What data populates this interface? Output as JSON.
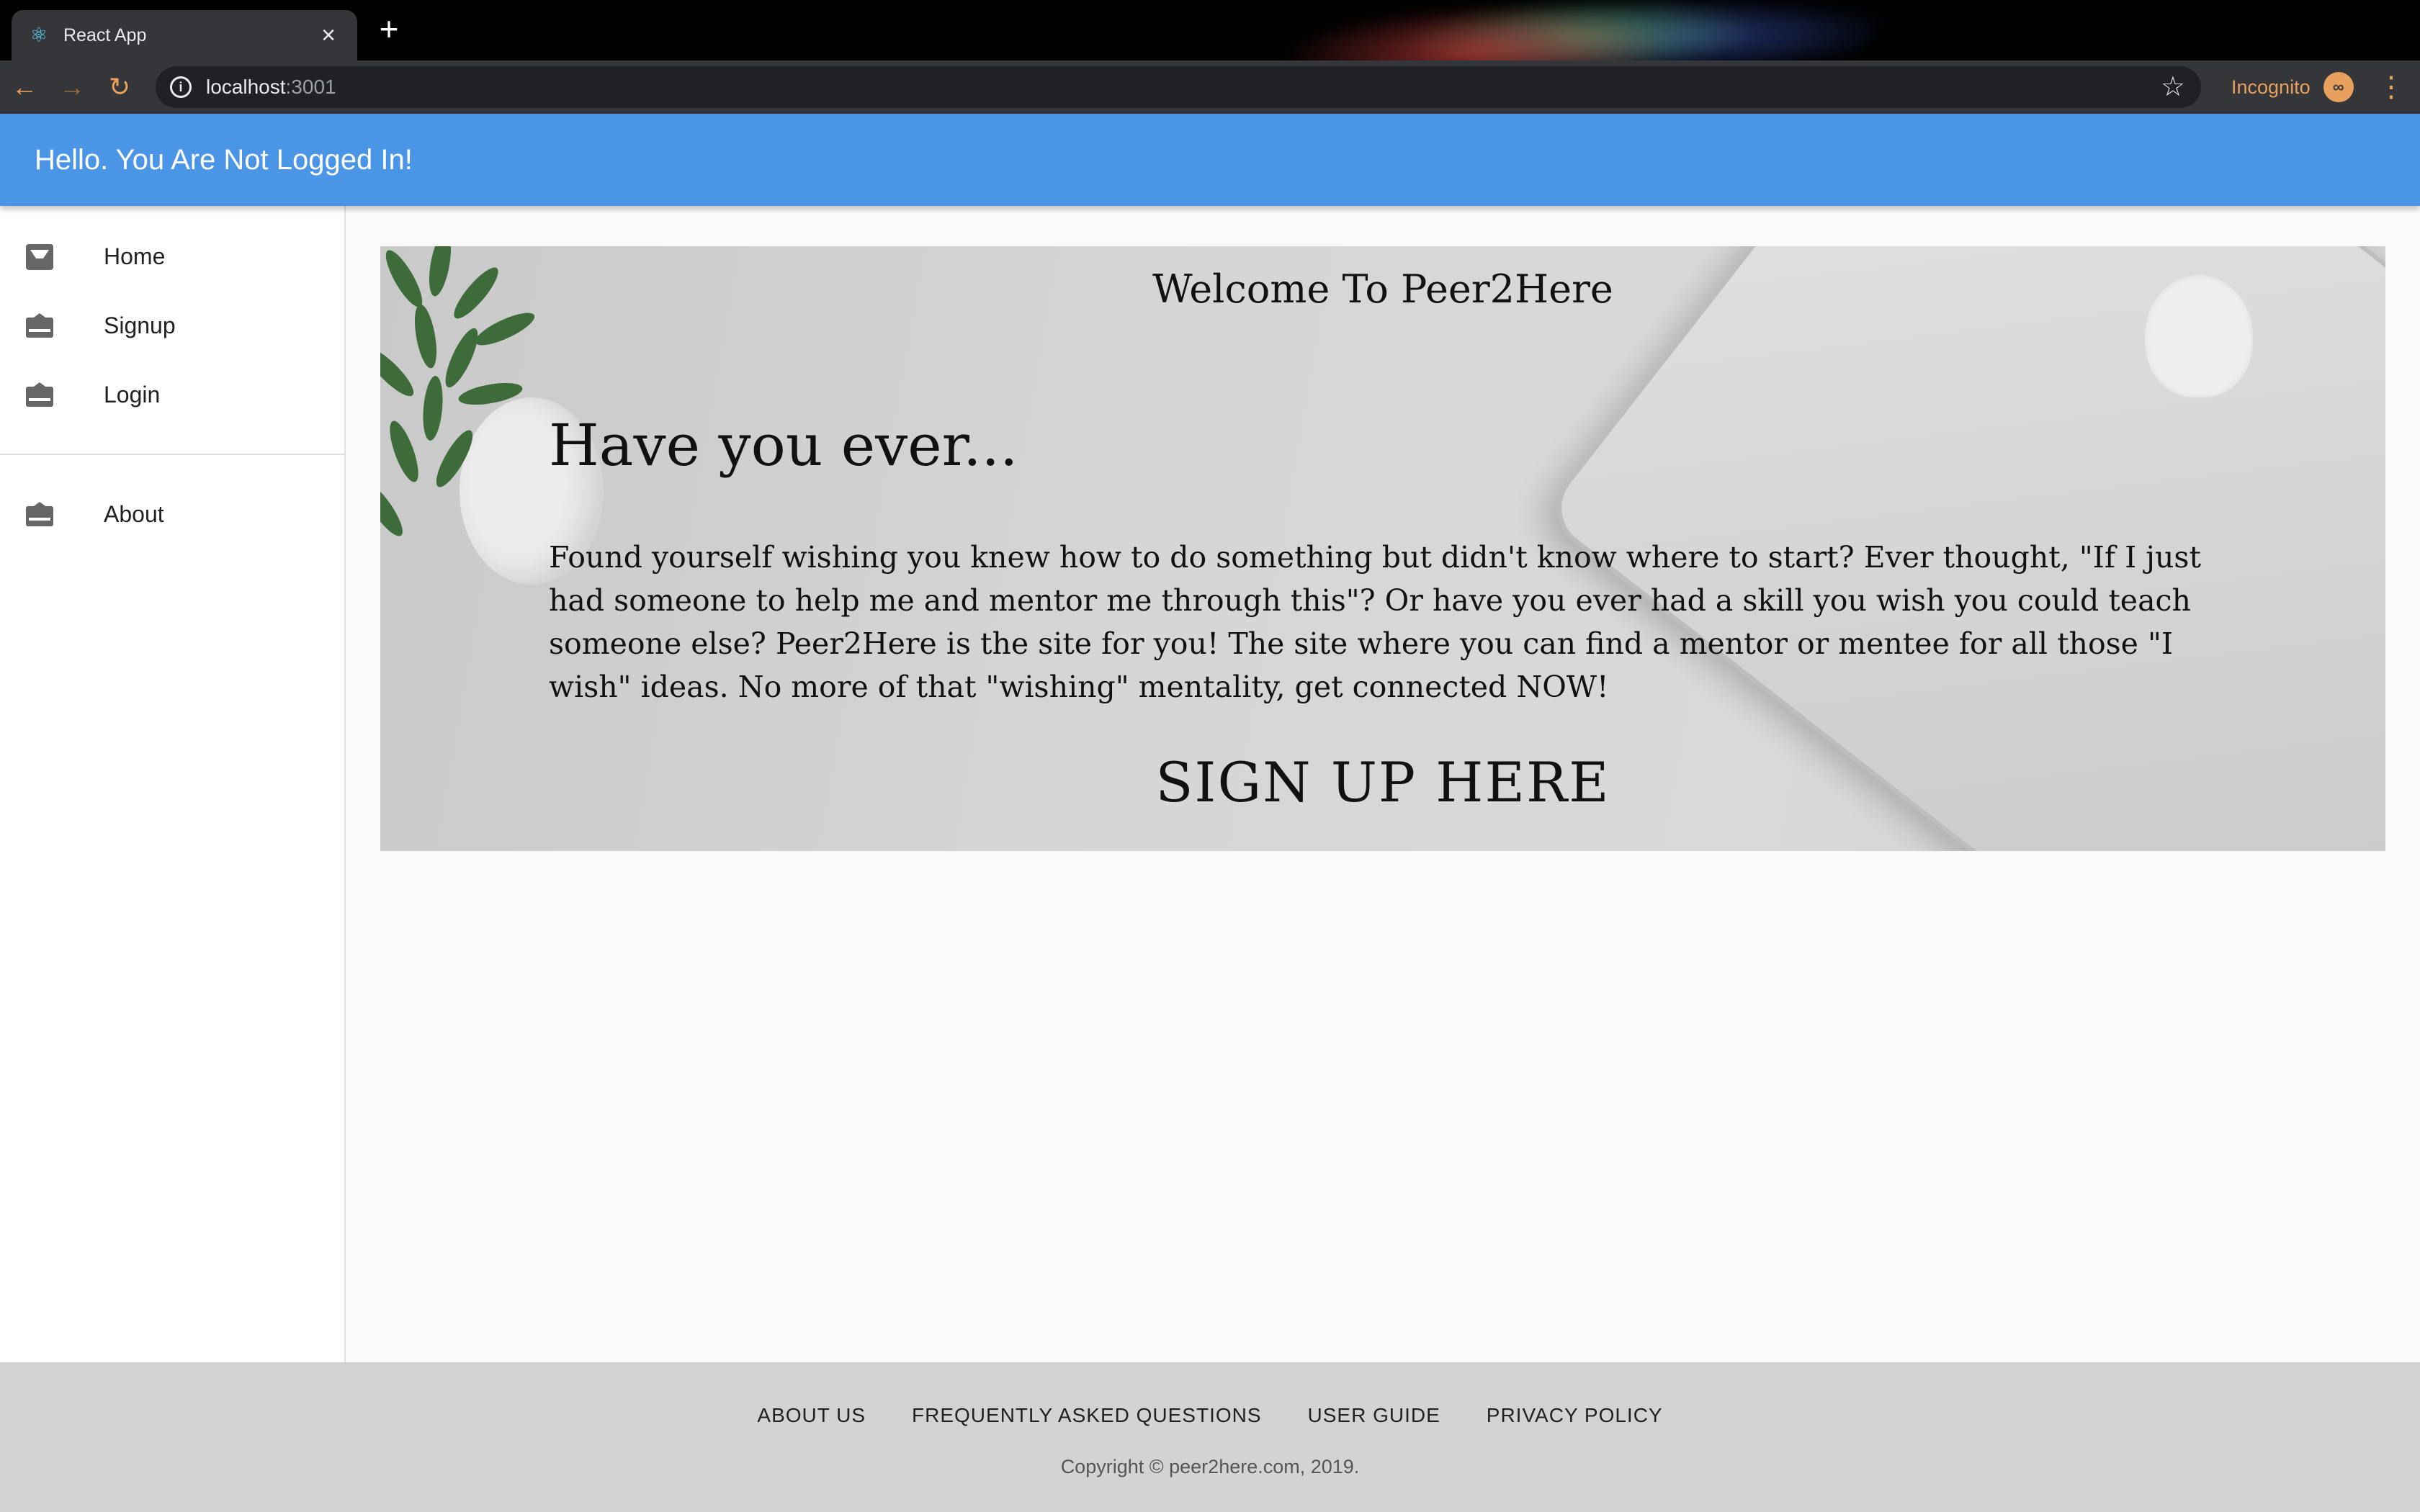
{
  "browser": {
    "tab_title": "React App",
    "new_tab": "+",
    "close_tab": "×",
    "url_host": "localhost",
    "url_port": ":3001",
    "incognito_label": "Incognito"
  },
  "appbar": {
    "title": "Hello. You Are Not Logged In!"
  },
  "sidebar": {
    "items": [
      {
        "label": "Home",
        "icon": "inbox-download-icon"
      },
      {
        "label": "Signup",
        "icon": "envelope-open-icon"
      },
      {
        "label": "Login",
        "icon": "envelope-open-icon"
      },
      {
        "label": "About",
        "icon": "envelope-open-icon"
      }
    ]
  },
  "hero": {
    "title": "Welcome To Peer2Here",
    "heading": "Have you ever...",
    "body": "Found yourself wishing you knew how to do something but didn't know where to start? Ever thought, \"If I just had someone to help me and mentor me through this\"? Or have you ever had a skill you wish you could teach someone else? Peer2Here is the site for you! The site where you can find a mentor or mentee for all those \"I wish\" ideas. No more of that \"wishing\" mentality, get connected NOW!",
    "cta": "SIGN UP HERE"
  },
  "footer": {
    "links": [
      "ABOUT US",
      "FREQUENTLY ASKED QUESTIONS",
      "USER GUIDE",
      "PRIVACY POLICY"
    ],
    "copyright": "Copyright © peer2here.com, 2019."
  },
  "colors": {
    "appbar": "#4a95e6",
    "footer": "#d3d3d3",
    "incognito_accent": "#e8a05e"
  }
}
